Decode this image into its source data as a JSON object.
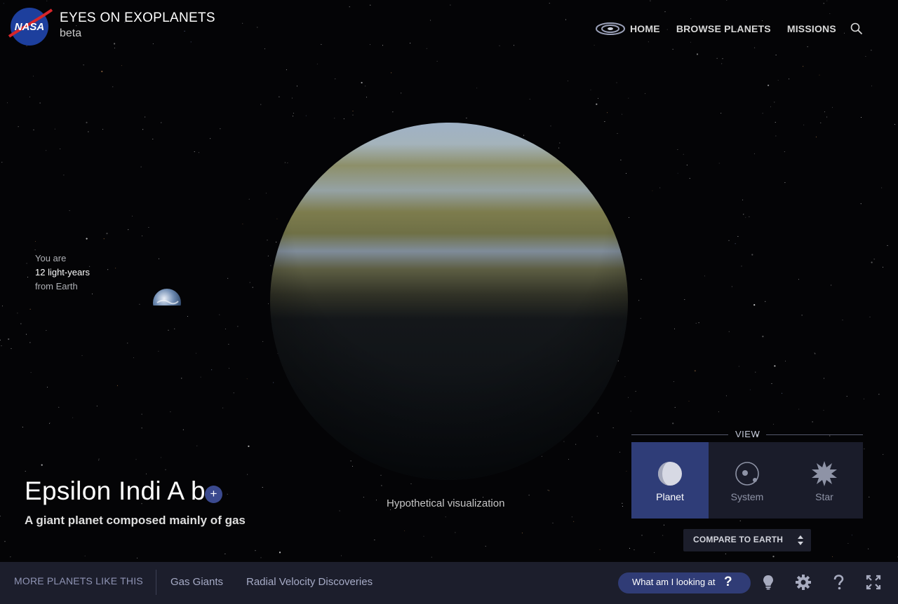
{
  "header": {
    "logo_text": "NASA",
    "title": "EYES ON EXOPLANETS",
    "subtitle": "beta",
    "nav": [
      {
        "label": "HOME"
      },
      {
        "label": "BROWSE PLANETS"
      },
      {
        "label": "MISSIONS"
      }
    ]
  },
  "distance": {
    "line1": "You are",
    "line2": "12 light-years",
    "line3": "from Earth"
  },
  "planet": {
    "name": "Epsilon Indi A b",
    "add_label": "+",
    "description": "A giant planet composed mainly of gas",
    "caption": "Hypothetical visualization"
  },
  "view_panel": {
    "label": "VIEW",
    "options": [
      {
        "label": "Planet",
        "active": true
      },
      {
        "label": "System",
        "active": false
      },
      {
        "label": "Star",
        "active": false
      }
    ],
    "compare_label": "COMPARE TO EARTH"
  },
  "bottom_bar": {
    "more_label": "MORE PLANETS LIKE THIS",
    "categories": [
      {
        "label": "Gas Giants"
      },
      {
        "label": "Radial Velocity Discoveries"
      }
    ],
    "what_label": "What am I looking at",
    "what_icon": "?"
  },
  "colors": {
    "accent": "#2f3d78",
    "bar_bg": "#1c1e2c",
    "panel_bg": "#1a1c2a"
  }
}
